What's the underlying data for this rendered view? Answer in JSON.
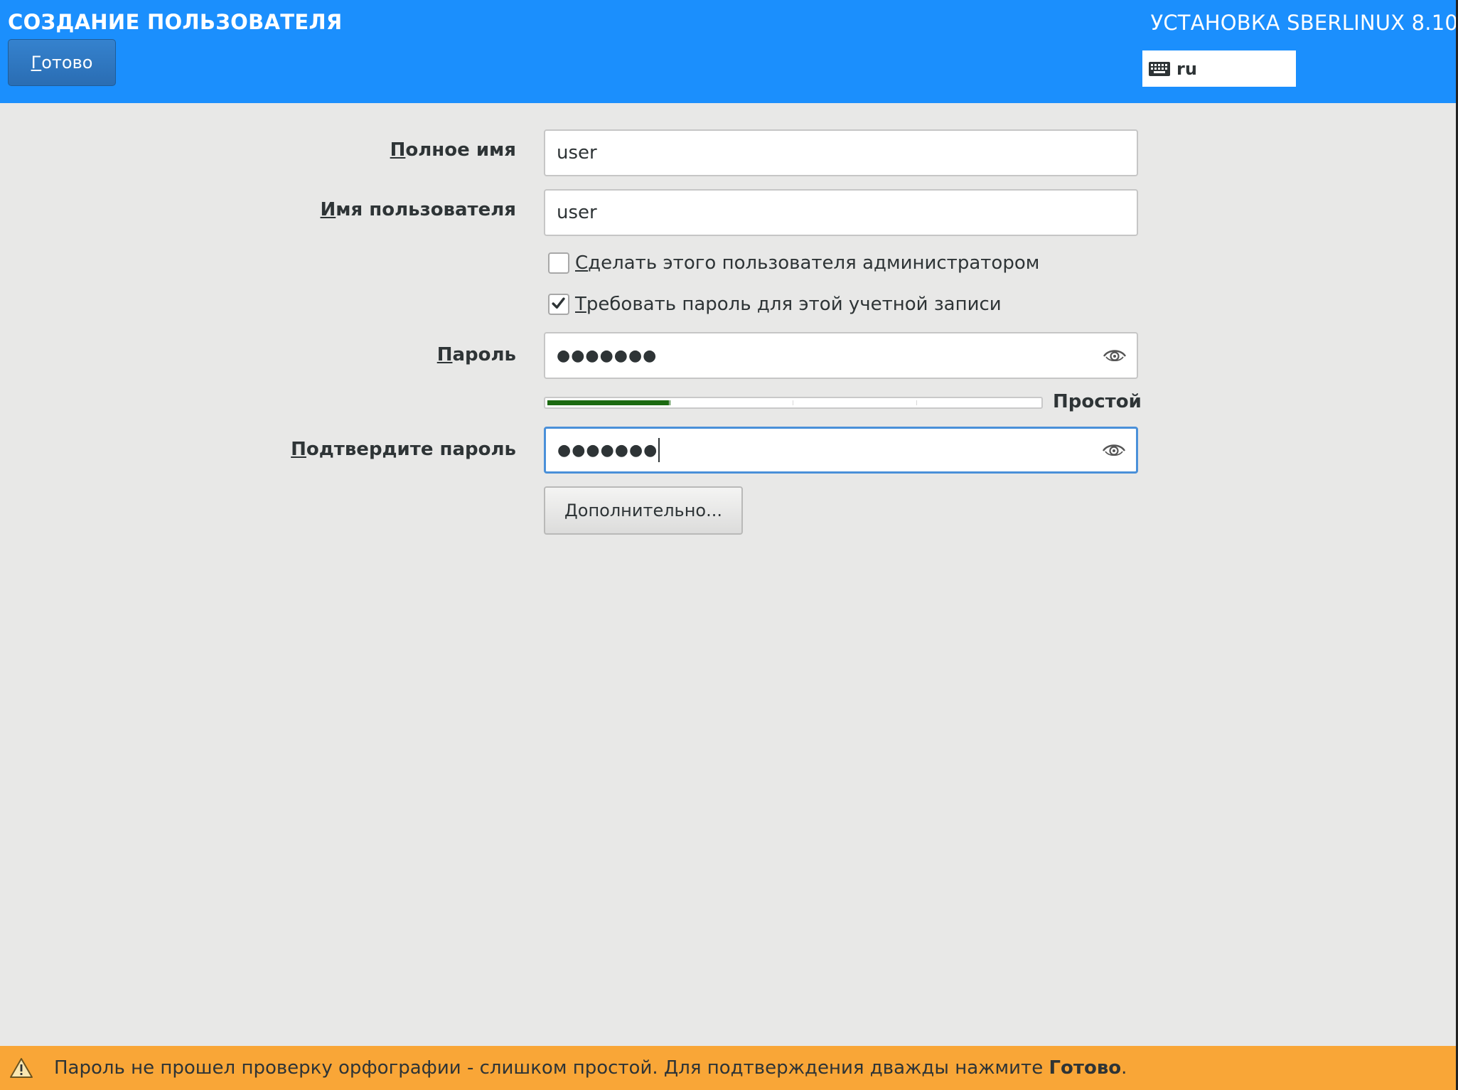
{
  "header": {
    "spoke_title": "СОЗДАНИЕ ПОЛЬЗОВАТЕЛЯ",
    "done_button": {
      "mnemonic": "Г",
      "rest": "отово"
    },
    "product_title": "УСТАНОВКА SBERLINUX 8.10",
    "keyboard_layout": "ru",
    "keyboard_icon": "keyboard-icon"
  },
  "form": {
    "fullname": {
      "label_mnemonic": "П",
      "label_rest": "олное имя",
      "value": "user"
    },
    "username": {
      "label_mnemonic": "И",
      "label_rest": "мя пользователя",
      "value": "user"
    },
    "admin_checkbox": {
      "label_mnemonic": "С",
      "label_rest": "делать этого пользователя администратором",
      "checked": false
    },
    "require_password_checkbox": {
      "label_mnemonic": "Т",
      "label_rest": "ребовать пароль для этой учетной записи",
      "checked": true
    },
    "password": {
      "label_mnemonic": "П",
      "label_rest": "ароль",
      "masked_value": "●●●●●●●",
      "reveal_icon": "eye-icon"
    },
    "strength": {
      "level": 0.25,
      "segments": 4,
      "label": "Простой",
      "color": "#1c6a11"
    },
    "confirm_password": {
      "label_mnemonic": "П",
      "label_rest": "одтвердите пароль",
      "masked_value": "●●●●●●●",
      "reveal_icon": "eye-icon"
    },
    "advanced_button": {
      "mnemonic": "Д",
      "rest": "ополнительно..."
    }
  },
  "warning": {
    "icon": "warning-icon",
    "text": "Пароль не прошел проверку орфографии - слишком простой. Для подтверждения дважды нажмите ",
    "bold": "Готово",
    "tail": "."
  },
  "colors": {
    "header_bg": "#1b8ffd",
    "warning_bg": "#f9a637",
    "focus_border": "#4a90d9"
  }
}
